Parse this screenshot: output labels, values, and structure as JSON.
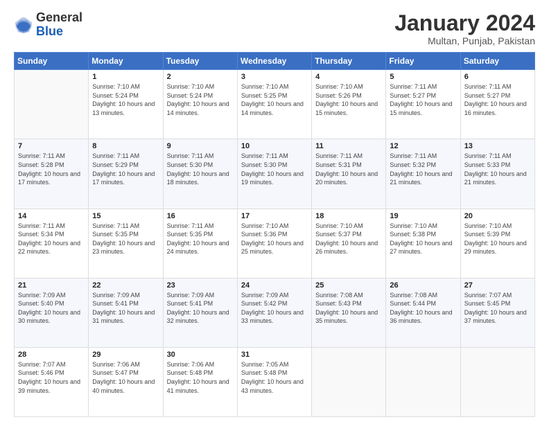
{
  "logo": {
    "line1": "General",
    "line2": "Blue"
  },
  "title": "January 2024",
  "subtitle": "Multan, Punjab, Pakistan",
  "weekdays": [
    "Sunday",
    "Monday",
    "Tuesday",
    "Wednesday",
    "Thursday",
    "Friday",
    "Saturday"
  ],
  "weeks": [
    [
      {
        "day": "",
        "sunrise": "",
        "sunset": "",
        "daylight": ""
      },
      {
        "day": "1",
        "sunrise": "Sunrise: 7:10 AM",
        "sunset": "Sunset: 5:24 PM",
        "daylight": "Daylight: 10 hours and 13 minutes."
      },
      {
        "day": "2",
        "sunrise": "Sunrise: 7:10 AM",
        "sunset": "Sunset: 5:24 PM",
        "daylight": "Daylight: 10 hours and 14 minutes."
      },
      {
        "day": "3",
        "sunrise": "Sunrise: 7:10 AM",
        "sunset": "Sunset: 5:25 PM",
        "daylight": "Daylight: 10 hours and 14 minutes."
      },
      {
        "day": "4",
        "sunrise": "Sunrise: 7:10 AM",
        "sunset": "Sunset: 5:26 PM",
        "daylight": "Daylight: 10 hours and 15 minutes."
      },
      {
        "day": "5",
        "sunrise": "Sunrise: 7:11 AM",
        "sunset": "Sunset: 5:27 PM",
        "daylight": "Daylight: 10 hours and 15 minutes."
      },
      {
        "day": "6",
        "sunrise": "Sunrise: 7:11 AM",
        "sunset": "Sunset: 5:27 PM",
        "daylight": "Daylight: 10 hours and 16 minutes."
      }
    ],
    [
      {
        "day": "7",
        "sunrise": "Sunrise: 7:11 AM",
        "sunset": "Sunset: 5:28 PM",
        "daylight": "Daylight: 10 hours and 17 minutes."
      },
      {
        "day": "8",
        "sunrise": "Sunrise: 7:11 AM",
        "sunset": "Sunset: 5:29 PM",
        "daylight": "Daylight: 10 hours and 17 minutes."
      },
      {
        "day": "9",
        "sunrise": "Sunrise: 7:11 AM",
        "sunset": "Sunset: 5:30 PM",
        "daylight": "Daylight: 10 hours and 18 minutes."
      },
      {
        "day": "10",
        "sunrise": "Sunrise: 7:11 AM",
        "sunset": "Sunset: 5:30 PM",
        "daylight": "Daylight: 10 hours and 19 minutes."
      },
      {
        "day": "11",
        "sunrise": "Sunrise: 7:11 AM",
        "sunset": "Sunset: 5:31 PM",
        "daylight": "Daylight: 10 hours and 20 minutes."
      },
      {
        "day": "12",
        "sunrise": "Sunrise: 7:11 AM",
        "sunset": "Sunset: 5:32 PM",
        "daylight": "Daylight: 10 hours and 21 minutes."
      },
      {
        "day": "13",
        "sunrise": "Sunrise: 7:11 AM",
        "sunset": "Sunset: 5:33 PM",
        "daylight": "Daylight: 10 hours and 21 minutes."
      }
    ],
    [
      {
        "day": "14",
        "sunrise": "Sunrise: 7:11 AM",
        "sunset": "Sunset: 5:34 PM",
        "daylight": "Daylight: 10 hours and 22 minutes."
      },
      {
        "day": "15",
        "sunrise": "Sunrise: 7:11 AM",
        "sunset": "Sunset: 5:35 PM",
        "daylight": "Daylight: 10 hours and 23 minutes."
      },
      {
        "day": "16",
        "sunrise": "Sunrise: 7:11 AM",
        "sunset": "Sunset: 5:35 PM",
        "daylight": "Daylight: 10 hours and 24 minutes."
      },
      {
        "day": "17",
        "sunrise": "Sunrise: 7:10 AM",
        "sunset": "Sunset: 5:36 PM",
        "daylight": "Daylight: 10 hours and 25 minutes."
      },
      {
        "day": "18",
        "sunrise": "Sunrise: 7:10 AM",
        "sunset": "Sunset: 5:37 PM",
        "daylight": "Daylight: 10 hours and 26 minutes."
      },
      {
        "day": "19",
        "sunrise": "Sunrise: 7:10 AM",
        "sunset": "Sunset: 5:38 PM",
        "daylight": "Daylight: 10 hours and 27 minutes."
      },
      {
        "day": "20",
        "sunrise": "Sunrise: 7:10 AM",
        "sunset": "Sunset: 5:39 PM",
        "daylight": "Daylight: 10 hours and 29 minutes."
      }
    ],
    [
      {
        "day": "21",
        "sunrise": "Sunrise: 7:09 AM",
        "sunset": "Sunset: 5:40 PM",
        "daylight": "Daylight: 10 hours and 30 minutes."
      },
      {
        "day": "22",
        "sunrise": "Sunrise: 7:09 AM",
        "sunset": "Sunset: 5:41 PM",
        "daylight": "Daylight: 10 hours and 31 minutes."
      },
      {
        "day": "23",
        "sunrise": "Sunrise: 7:09 AM",
        "sunset": "Sunset: 5:41 PM",
        "daylight": "Daylight: 10 hours and 32 minutes."
      },
      {
        "day": "24",
        "sunrise": "Sunrise: 7:09 AM",
        "sunset": "Sunset: 5:42 PM",
        "daylight": "Daylight: 10 hours and 33 minutes."
      },
      {
        "day": "25",
        "sunrise": "Sunrise: 7:08 AM",
        "sunset": "Sunset: 5:43 PM",
        "daylight": "Daylight: 10 hours and 35 minutes."
      },
      {
        "day": "26",
        "sunrise": "Sunrise: 7:08 AM",
        "sunset": "Sunset: 5:44 PM",
        "daylight": "Daylight: 10 hours and 36 minutes."
      },
      {
        "day": "27",
        "sunrise": "Sunrise: 7:07 AM",
        "sunset": "Sunset: 5:45 PM",
        "daylight": "Daylight: 10 hours and 37 minutes."
      }
    ],
    [
      {
        "day": "28",
        "sunrise": "Sunrise: 7:07 AM",
        "sunset": "Sunset: 5:46 PM",
        "daylight": "Daylight: 10 hours and 39 minutes."
      },
      {
        "day": "29",
        "sunrise": "Sunrise: 7:06 AM",
        "sunset": "Sunset: 5:47 PM",
        "daylight": "Daylight: 10 hours and 40 minutes."
      },
      {
        "day": "30",
        "sunrise": "Sunrise: 7:06 AM",
        "sunset": "Sunset: 5:48 PM",
        "daylight": "Daylight: 10 hours and 41 minutes."
      },
      {
        "day": "31",
        "sunrise": "Sunrise: 7:05 AM",
        "sunset": "Sunset: 5:48 PM",
        "daylight": "Daylight: 10 hours and 43 minutes."
      },
      {
        "day": "",
        "sunrise": "",
        "sunset": "",
        "daylight": ""
      },
      {
        "day": "",
        "sunrise": "",
        "sunset": "",
        "daylight": ""
      },
      {
        "day": "",
        "sunrise": "",
        "sunset": "",
        "daylight": ""
      }
    ]
  ]
}
